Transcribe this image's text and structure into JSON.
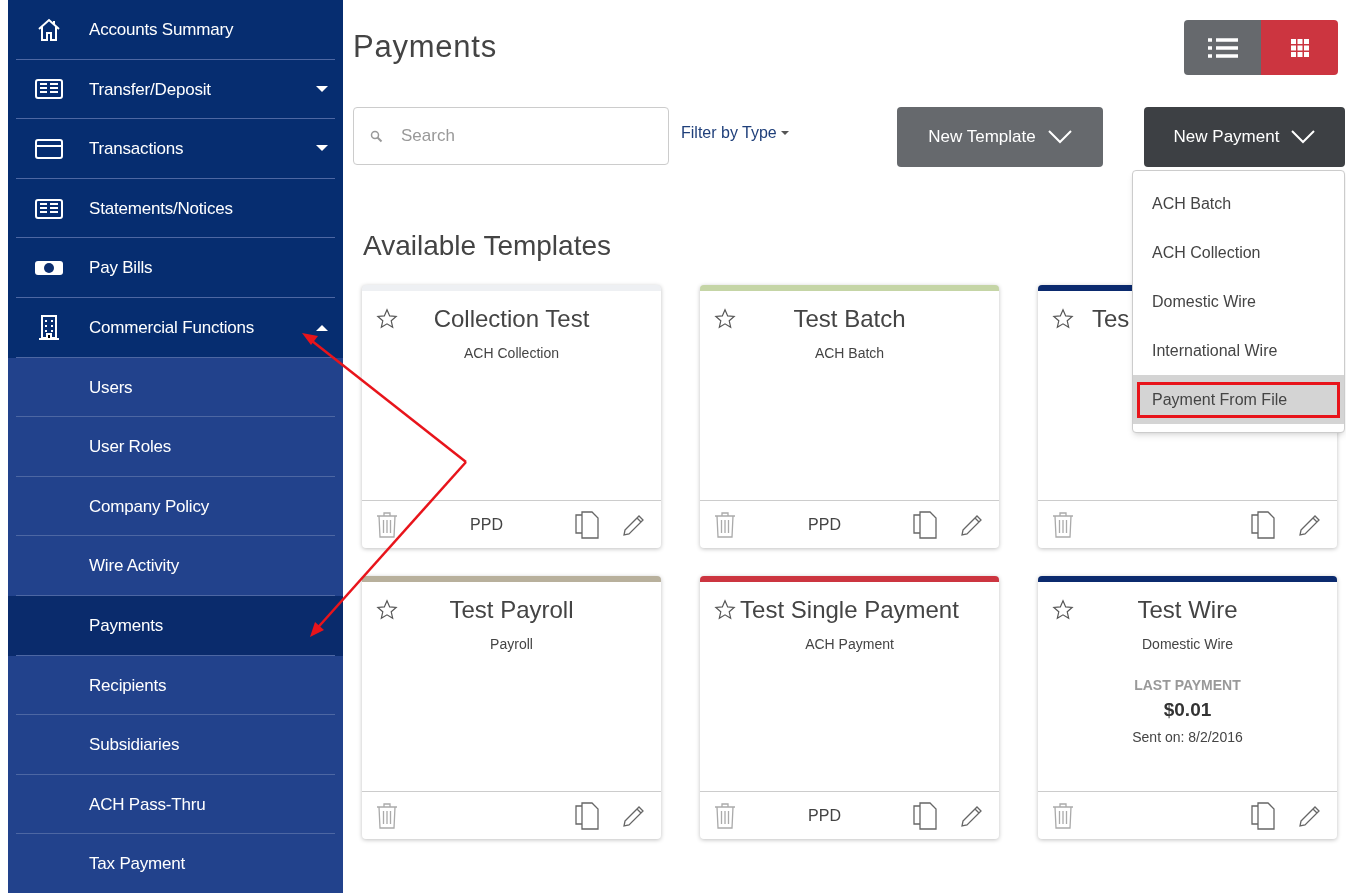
{
  "sidebar": {
    "items": [
      {
        "label": "Accounts Summary",
        "kind": "home",
        "selected": false
      },
      {
        "label": "Transfer/Deposit",
        "kind": "ledger",
        "selected": false,
        "expanded": false
      },
      {
        "label": "Transactions",
        "kind": "card",
        "selected": false,
        "expanded": false
      },
      {
        "label": "Statements/Notices",
        "kind": "ledger",
        "selected": false
      },
      {
        "label": "Pay Bills",
        "kind": "cash",
        "selected": false
      },
      {
        "label": "Commercial Functions",
        "kind": "building",
        "selected": false,
        "expanded": true,
        "children": [
          {
            "label": "Users",
            "selected": false
          },
          {
            "label": "User Roles",
            "selected": false
          },
          {
            "label": "Company Policy",
            "selected": false
          },
          {
            "label": "Wire Activity",
            "selected": false
          },
          {
            "label": "Payments",
            "selected": true
          },
          {
            "label": "Recipients",
            "selected": false
          },
          {
            "label": "Subsidiaries",
            "selected": false
          },
          {
            "label": "ACH Pass-Thru",
            "selected": false
          },
          {
            "label": "Tax Payment",
            "selected": false
          }
        ]
      }
    ]
  },
  "page": {
    "title": "Payments",
    "view_toggle": [
      {
        "kind": "list",
        "selected": false
      },
      {
        "kind": "grid",
        "selected": true
      }
    ],
    "search": {
      "placeholder": "Search"
    },
    "filter": {
      "label": "Filter by Type"
    },
    "new_template_button": "New Template",
    "new_payment_button": {
      "label": "New Payment",
      "expanded": true,
      "menu": [
        {
          "label": "ACH Batch",
          "selected": false,
          "outlined": false
        },
        {
          "label": "ACH Collection",
          "selected": false,
          "outlined": false
        },
        {
          "label": "Domestic Wire",
          "selected": false,
          "outlined": false
        },
        {
          "label": "International Wire",
          "selected": false,
          "outlined": false
        },
        {
          "label": "Payment From File",
          "selected": true,
          "outlined": true
        }
      ]
    },
    "section_title": "Available Templates",
    "templates": [
      {
        "title": "Collection Test",
        "type": "ACH Collection",
        "footer": "PPD",
        "color": "#eef0f3"
      },
      {
        "title": "Test Batch",
        "type": "ACH Batch",
        "footer": "PPD",
        "color": "#c5d5a6"
      },
      {
        "title": "Tes",
        "color": "#0b2a6e",
        "covered": true
      },
      {
        "title": "Test Payroll",
        "type": "Payroll",
        "color": "#b8b09c"
      },
      {
        "title": "Test Single Payment",
        "type": "ACH Payment",
        "footer": "PPD",
        "color": "#cc3540"
      },
      {
        "title": "Test Wire",
        "type": "Domestic Wire",
        "color": "#0b2a6e",
        "last_payment": {
          "label": "LAST PAYMENT",
          "amount": "$0.01",
          "sent": "Sent on: 8/2/2016"
        }
      }
    ]
  }
}
